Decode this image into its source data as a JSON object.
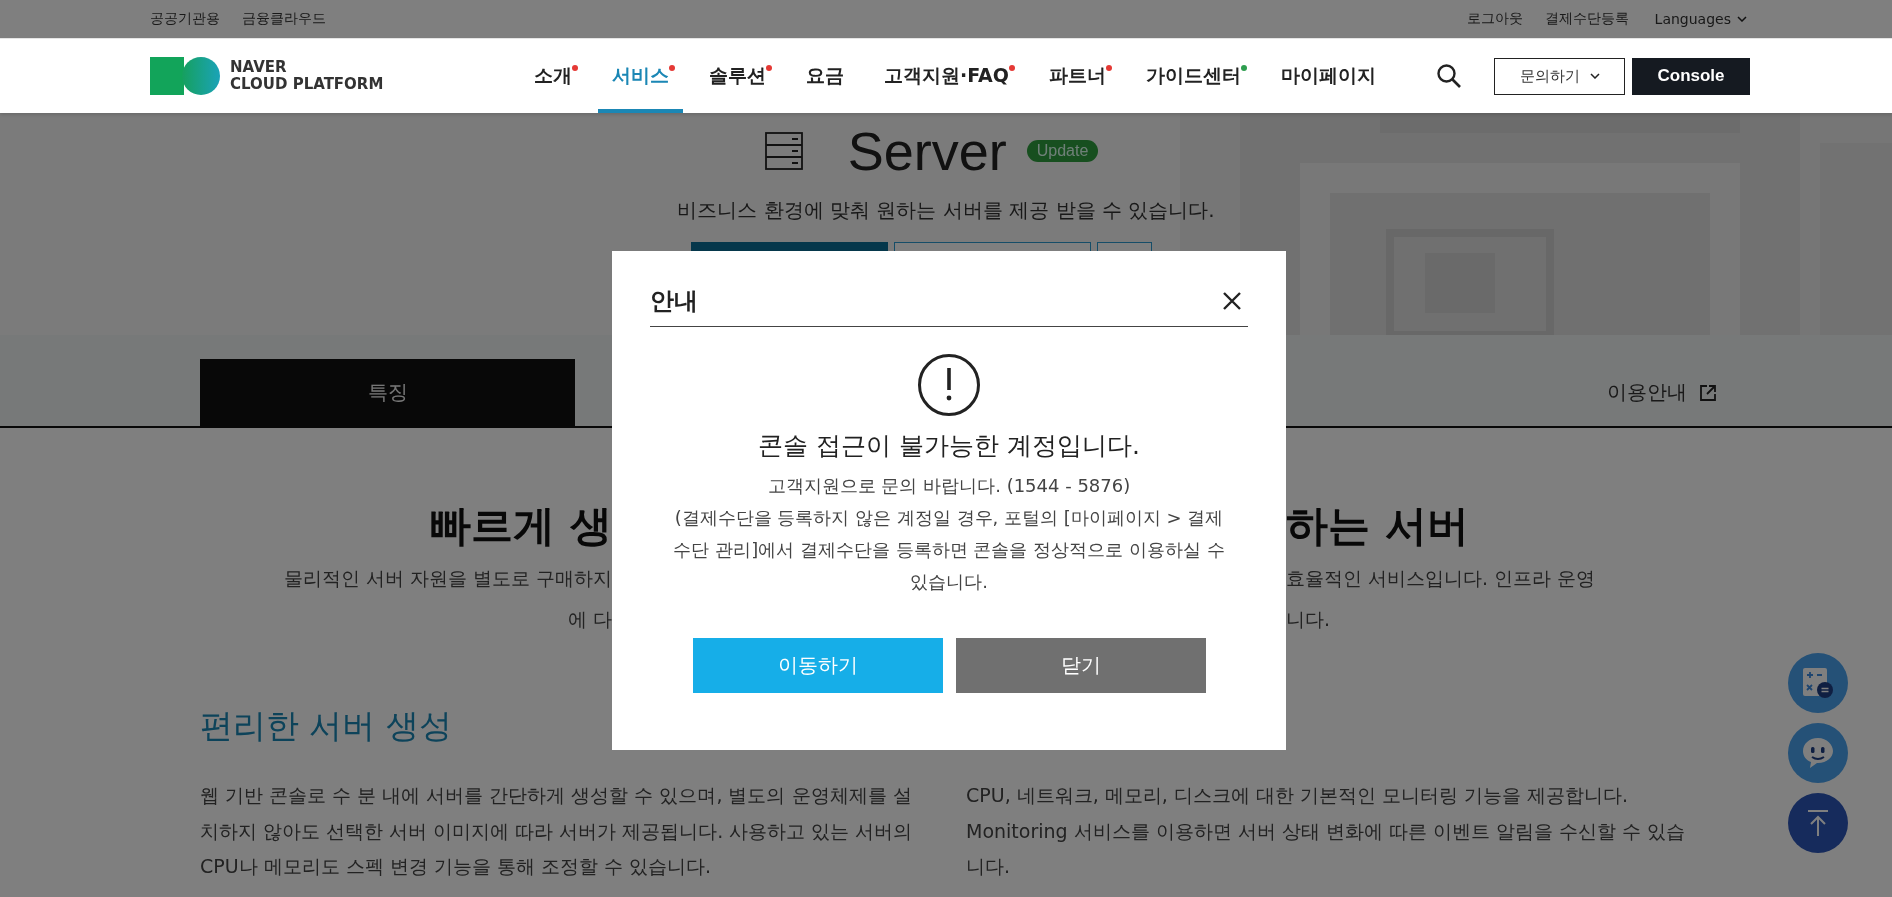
{
  "utility_bar": {
    "left_links": [
      "공공기관용",
      "금융클라우드"
    ],
    "right_links": [
      "로그아웃",
      "결제수단등록"
    ],
    "language": "Languages"
  },
  "header": {
    "logo_lines": [
      "NAVER",
      "CLOUD PLATFORM"
    ],
    "nav": [
      {
        "label": "소개",
        "selected": false,
        "color": "#e53935"
      },
      {
        "label": "서비스",
        "selected": true,
        "color": "#e53935"
      },
      {
        "label": "솔루션",
        "selected": false,
        "color": "#e53935"
      },
      {
        "label": "요금",
        "selected": false
      },
      {
        "label": "고객지원·FAQ",
        "selected": false,
        "color": "#e53935"
      },
      {
        "label": "파트너",
        "selected": false,
        "color": "#e53935"
      },
      {
        "label": "가이드센터",
        "selected": false,
        "color": "#2e9e4f"
      },
      {
        "label": "마이페이지",
        "selected": false
      }
    ],
    "inquiry_button": "문의하기",
    "console_button": "Console"
  },
  "hero": {
    "title": "Server",
    "badge": "Update",
    "subtitle": "비즈니스 환경에 맞춰 원하는 서버를 제공 받을 수 있습니다."
  },
  "tabs": [
    {
      "label": "특징",
      "selected": true,
      "external": false
    },
    {
      "label": "이용안내",
      "selected": false,
      "external": true
    }
  ],
  "intro": {
    "heading_parts": [
      "빠르게 생",
      "하는 서버"
    ],
    "lines": [
      [
        "물리적인 서버 자원을 별도로 구매하지",
        "효율적인 서비스입니다. 인프라 운영"
      ],
      [
        "에 다",
        "니다."
      ]
    ]
  },
  "features": [
    {
      "title": "편리한 서버 생성",
      "lines": [
        "웹 기반 콘솔로 수 분 내에 서버를 간단하게 생성할 수 있으며, 별도의 운영체제를 설",
        "치하지 않아도 선택한 서버 이미지에 따라 서버가 제공됩니다. 사용하고 있는 서버의",
        "CPU나 메모리도 스펙 변경 기능을 통해 조정할 수 있습니다."
      ]
    },
    {
      "lines": [
        "CPU, 네트워크, 메모리, 디스크에 대한 기본적인 모니터링 기능을 제공합니다.",
        "Monitoring 서비스를 이용하면 서버 상태 변화에 따른 이벤트 알림을 수신할 수 있습",
        "니다."
      ]
    }
  ],
  "floating_buttons": [
    {
      "kind": "calculator"
    },
    {
      "kind": "chatbot"
    },
    {
      "kind": "top"
    }
  ],
  "modal": {
    "title": "안내",
    "message": "콘솔 접근이 불가능한 계정입니다.",
    "contact": "고객지원으로 문의 바랍니다. (1544 - 5876)",
    "note_lines": [
      "(결제수단을 등록하지 않은 계정일 경우, 포털의 [마이페이지 > 결제",
      "수단 관리]에서 결제수단을 등록하면 콘솔을 정상적으로 이용하실 수",
      "있습니다."
    ],
    "buttons": [
      {
        "label": "이동하기",
        "kind": "primary"
      },
      {
        "label": "닫기",
        "kind": "secondary"
      }
    ]
  }
}
